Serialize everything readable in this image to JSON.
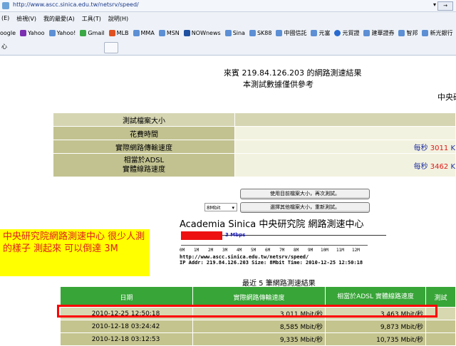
{
  "browser": {
    "url": "http://www.ascc.sinica.edu.tw/netsrv/speed/",
    "menu": [
      "(E)",
      "檢視(V)",
      "我的最愛(A)",
      "工具(T)",
      "說明(H)"
    ],
    "favorites": [
      "oogle",
      "Yahoo",
      "Yahoo!",
      "Gmail",
      "MLB",
      "MMA",
      "MSN",
      "NOWnews",
      "Sina",
      "SK88",
      "中國信託",
      "元富",
      "元貿證",
      "建華證券",
      "智邦",
      "新光銀行"
    ],
    "tab_title": "心"
  },
  "page": {
    "title_line1": "來賓 219.84.126.203 的網路測速結果",
    "title_line2": "本測試數據僅供參考",
    "org": "中央研",
    "result_rows": [
      {
        "label": "測試檔案大小",
        "value": ""
      },
      {
        "label": "花費時間",
        "value": ""
      },
      {
        "label": "實際網路傳輸速度",
        "prefix": "每秒",
        "number": "3011",
        "suffix": "K"
      },
      {
        "label": "相當於ADSL",
        "label2": "實體線路速度",
        "prefix": "每秒",
        "number": "3462",
        "suffix": "K"
      }
    ],
    "btn_retest_same": "使用目前檔案大小，再次測試。",
    "size_select": "8Mbit",
    "btn_retest_other": "選擇其他檔案大小，重新測試。",
    "speed_graphic": {
      "brand": "Academia Sinica 中央研究院 網路測速中心",
      "speed_label": "3 Mbps",
      "ticks": [
        "0M",
        "1M",
        "2M",
        "3M",
        "4M",
        "5M",
        "6M",
        "7M",
        "8M",
        "9M",
        "10M",
        "11M",
        "12M"
      ],
      "url_line": "http://www.ascc.sinica.edu.tw/netsrv/speed/",
      "info_line": "IP Addr: 219.84.126.203 Size: 8Mbit Time: 2010-12-25 12:50:18"
    },
    "note": "中央研究院網路測速中心 很少人測的樣子 測起來 可以倒達 3M",
    "recent_title": "最近 5 筆網路測速結果",
    "history_headers": [
      "日期",
      "實際網路傳輸速度",
      "相當於ADSL 實體線路速度",
      "測試"
    ],
    "history_rows": [
      {
        "date": "2010-12-25 12:50:18",
        "speed": "3,011 Mbit/秒",
        "adsl": "3,463 Mbit/秒"
      },
      {
        "date": "2010-12-18 03:24:42",
        "speed": "8,585 Mbit/秒",
        "adsl": "9,873 Mbit/秒"
      },
      {
        "date": "2010-12-18 03:12:53",
        "speed": "9,335 Mbit/秒",
        "adsl": "10,735 Mbit/秒"
      }
    ]
  }
}
